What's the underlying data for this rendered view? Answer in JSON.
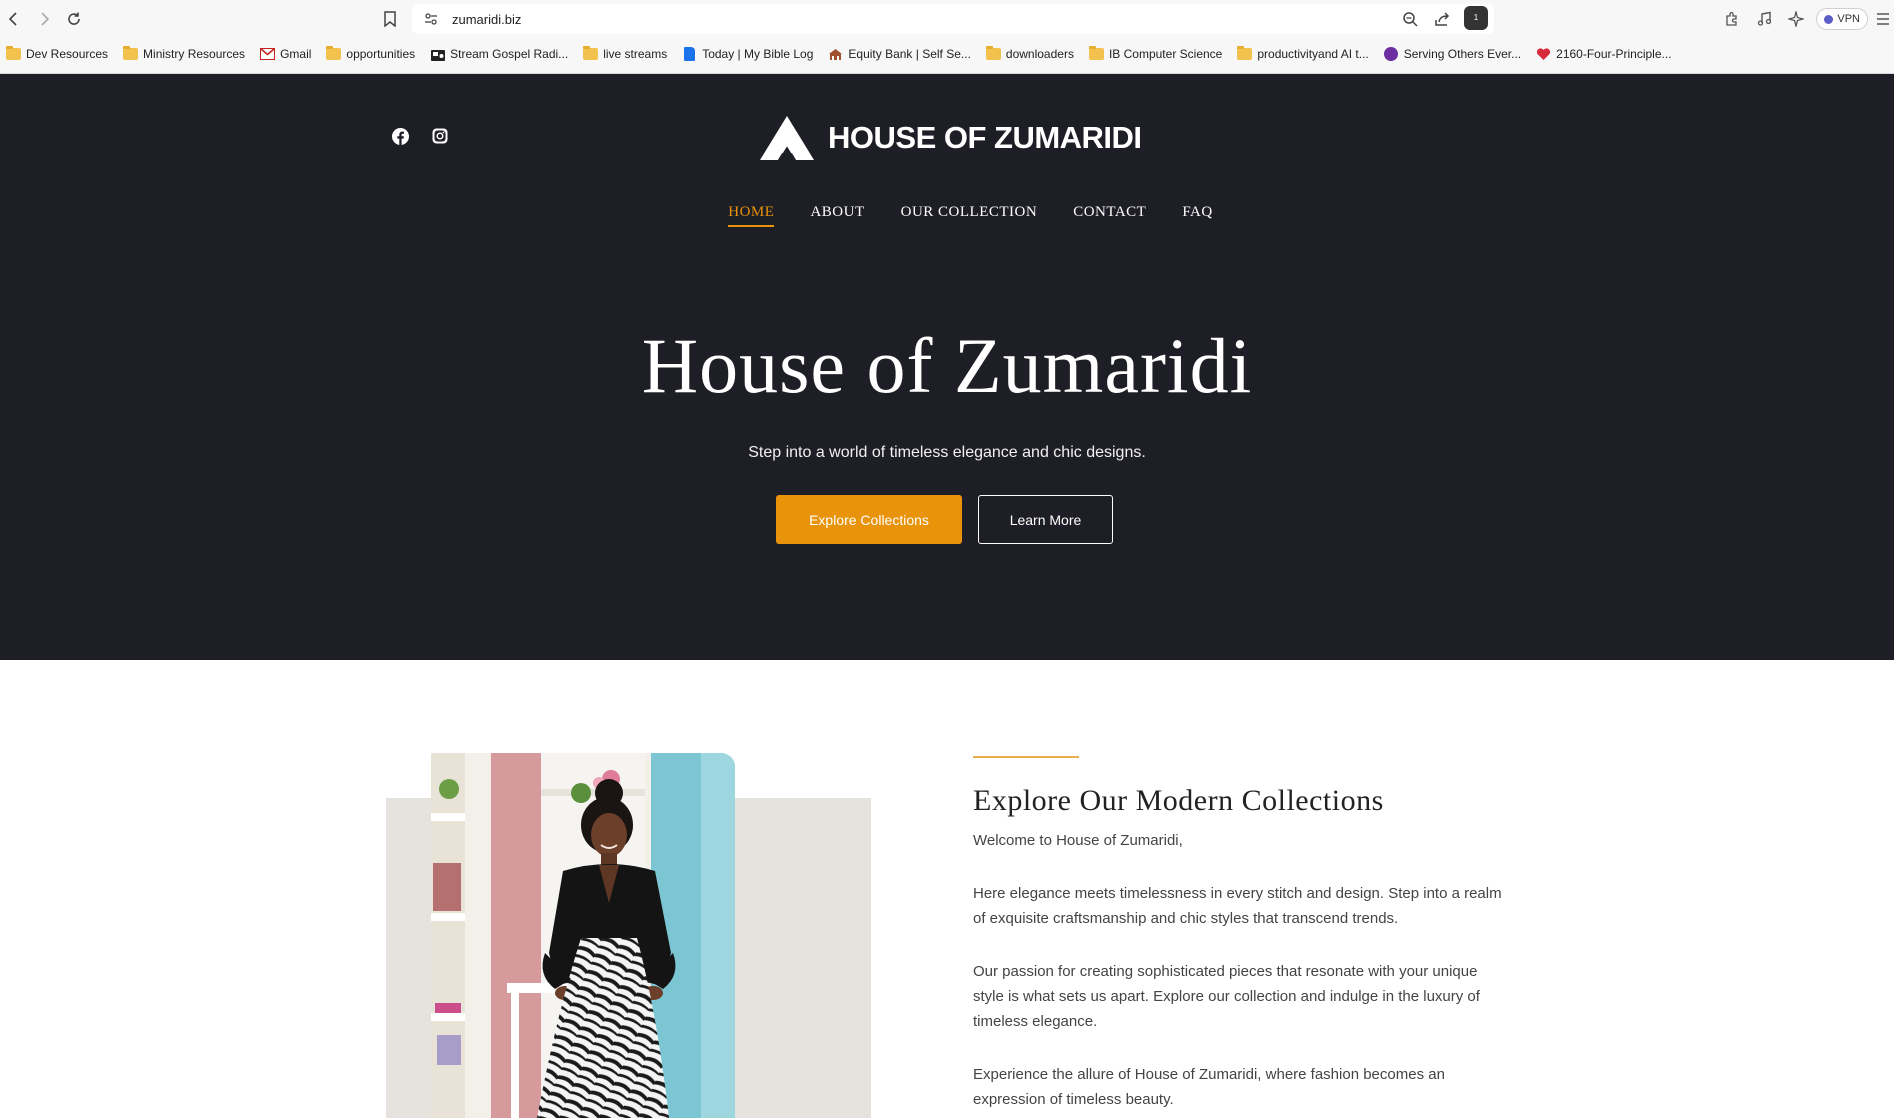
{
  "browser": {
    "url": "zumaridi.biz",
    "vpn_label": "VPN",
    "shield_count": "1",
    "bookmarks": [
      {
        "label": "Dev Resources",
        "icon": "folder-icon"
      },
      {
        "label": "Ministry Resources",
        "icon": "folder-icon"
      },
      {
        "label": "Gmail",
        "icon": "gmail-icon"
      },
      {
        "label": "opportunities",
        "icon": "folder-icon"
      },
      {
        "label": "Stream Gospel Radi...",
        "icon": "radio-icon"
      },
      {
        "label": "live streams",
        "icon": "folder-icon"
      },
      {
        "label": "Today | My Bible Log",
        "icon": "bible-log-icon"
      },
      {
        "label": "Equity Bank | Self Se...",
        "icon": "equity-bank-icon"
      },
      {
        "label": "downloaders",
        "icon": "folder-icon"
      },
      {
        "label": "IB Computer Science",
        "icon": "folder-icon"
      },
      {
        "label": "productivityand AI t...",
        "icon": "folder-icon"
      },
      {
        "label": "Serving Others Ever...",
        "icon": "serving-others-icon"
      },
      {
        "label": "2160-Four-Principle...",
        "icon": "heart-icon"
      }
    ]
  },
  "site": {
    "brand": "HOUSE OF ZUMARIDI",
    "nav": [
      "HOME",
      "ABOUT",
      "OUR COLLECTION",
      "CONTACT",
      "FAQ"
    ],
    "active_nav": "HOME",
    "hero": {
      "title": "House of Zumaridi",
      "subtitle": "Step into a world of timeless elegance and chic designs.",
      "primary_button": "Explore Collections",
      "secondary_button": "Learn More"
    },
    "about": {
      "title": "Explore Our Modern Collections",
      "paragraphs": [
        "Welcome to House of Zumaridi,",
        "Here elegance meets timelessness in every stitch and design. Step into a realm of exquisite craftsmanship and chic styles that transcend trends.",
        "Our passion for creating sophisticated pieces that resonate with your unique style is what sets us apart. Explore our collection and indulge in the luxury of timeless elegance.",
        "Experience the allure of House of Zumaridi, where fashion becomes an expression of timeless beauty."
      ]
    }
  },
  "colors": {
    "hero_bg": "#1e1e26",
    "accent": "#e8930a",
    "photo_backdrop": "#e6e3de"
  }
}
